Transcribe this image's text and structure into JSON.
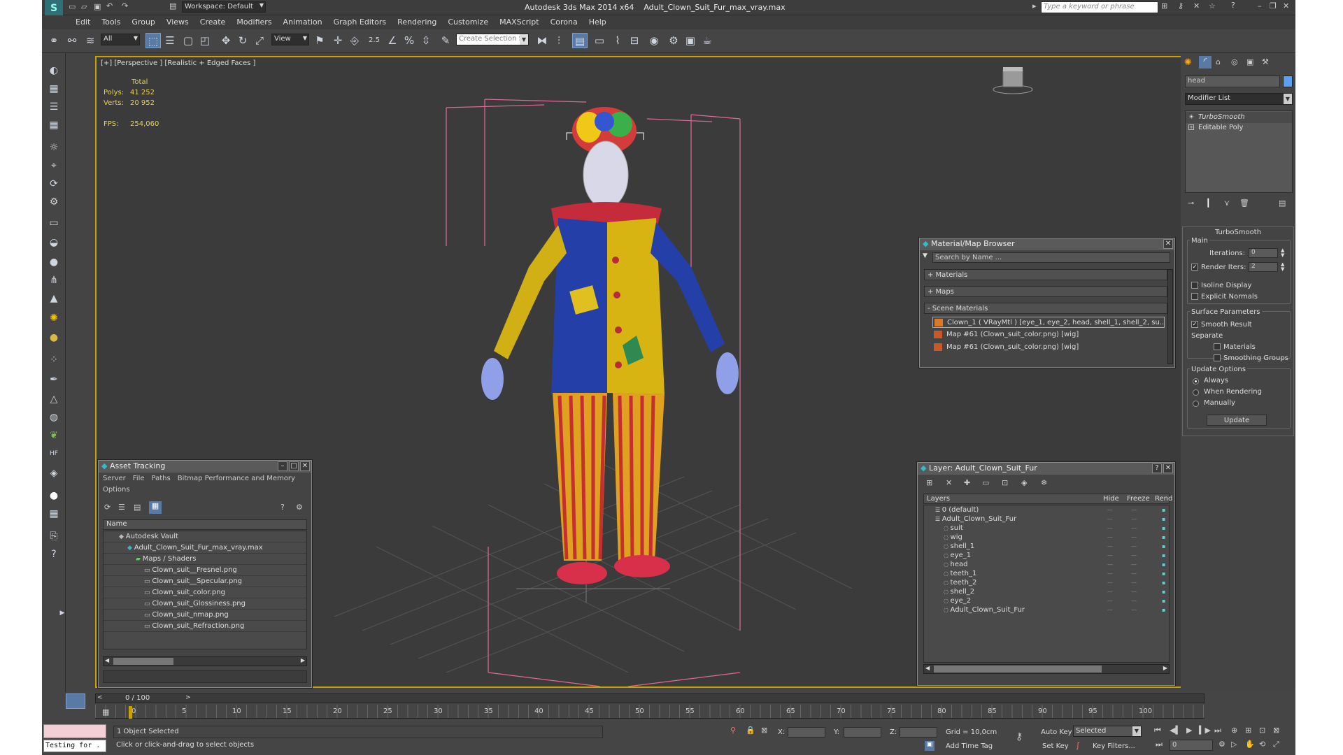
{
  "title": {
    "app": "Autodesk 3ds Max  2014 x64",
    "file": "Adult_Clown_Suit_Fur_max_vray.max",
    "workspace": "Workspace: Default",
    "search_placeholder": "Type a keyword or phrase"
  },
  "menu": [
    "Edit",
    "Tools",
    "Group",
    "Views",
    "Create",
    "Modifiers",
    "Animation",
    "Graph Editors",
    "Rendering",
    "Customize",
    "MAXScript",
    "Corona",
    "Help"
  ],
  "toolbar": {
    "filter": "All",
    "refcoord": "View",
    "snap_angle": "2.5",
    "named_selection": "Create Selection Se"
  },
  "viewport": {
    "label": "[+] [Perspective ] [Realistic + Edged Faces ]",
    "stats_header": "Total",
    "polys_label": "Polys:",
    "polys_value": "41 252",
    "verts_label": "Verts:",
    "verts_value": "20 952",
    "fps_label": "FPS:",
    "fps_value": "254,060"
  },
  "command_panel": {
    "object_name": "head",
    "modifier_list": "Modifier List",
    "stack": [
      "TurboSmooth",
      "Editable Poly"
    ],
    "rollout_title": "TurboSmooth",
    "main_group": "Main",
    "iterations_label": "Iterations:",
    "iterations_value": "0",
    "render_iters_label": "Render Iters:",
    "render_iters_value": "2",
    "isoline": "Isoline Display",
    "explicit_normals": "Explicit Normals",
    "surface_group": "Surface Parameters",
    "smooth_result": "Smooth Result",
    "separate_label": "Separate",
    "materials": "Materials",
    "smoothing_groups": "Smoothing Groups",
    "update_group": "Update Options",
    "always": "Always",
    "when_rendering": "When Rendering",
    "manually": "Manually",
    "update_button": "Update"
  },
  "material_browser": {
    "title": "Material/Map Browser",
    "search_placeholder": "Search by Name ...",
    "sections": [
      "+ Materials",
      "+ Maps",
      "- Scene Materials"
    ],
    "items": [
      "Clown_1  ( VRayMtl )  [eye_1, eye_2, head, shell_1, shell_2, su...",
      "Map #61 (Clown_suit_color.png)  [wig]",
      "Map #61 (Clown_suit_color.png)  [wig]"
    ]
  },
  "asset_tracking": {
    "title": "Asset Tracking",
    "menu": [
      "Server",
      "File",
      "Paths",
      "Bitmap Performance and Memory"
    ],
    "options": "Options",
    "column": "Name",
    "tree": [
      {
        "text": "Autodesk Vault",
        "level": 1
      },
      {
        "text": "Adult_Clown_Suit_Fur_max_vray.max",
        "level": 2
      },
      {
        "text": "Maps / Shaders",
        "level": 3
      },
      {
        "text": "Clown_suit__Fresnel.png",
        "level": 4
      },
      {
        "text": "Clown_suit__Specular.png",
        "level": 4
      },
      {
        "text": "Clown_suit_color.png",
        "level": 4
      },
      {
        "text": "Clown_suit_Glossiness.png",
        "level": 4
      },
      {
        "text": "Clown_suit_nmap.png",
        "level": 4
      },
      {
        "text": "Clown_suit_Refraction.png",
        "level": 4
      }
    ]
  },
  "layer_panel": {
    "title": "Layer: Adult_Clown_Suit_Fur",
    "help": "?",
    "columns": [
      "Layers",
      "Hide",
      "Freeze",
      "Rend"
    ],
    "layers": [
      {
        "text": "0 (default)",
        "level": 1
      },
      {
        "text": "Adult_Clown_Suit_Fur",
        "level": 1
      },
      {
        "text": "suit",
        "level": 2
      },
      {
        "text": "wig",
        "level": 2
      },
      {
        "text": "shell_1",
        "level": 2
      },
      {
        "text": "eye_1",
        "level": 2
      },
      {
        "text": "head",
        "level": 2
      },
      {
        "text": "teeth_1",
        "level": 2
      },
      {
        "text": "teeth_2",
        "level": 2
      },
      {
        "text": "shell_2",
        "level": 2
      },
      {
        "text": "eye_2",
        "level": 2
      },
      {
        "text": "Adult_Clown_Suit_Fur",
        "level": 2
      }
    ]
  },
  "timeline": {
    "frame": "0 / 100",
    "ticks": [
      "0",
      "5",
      "10",
      "15",
      "20",
      "25",
      "30",
      "35",
      "40",
      "45",
      "50",
      "55",
      "60",
      "65",
      "70",
      "75",
      "80",
      "85",
      "90",
      "95",
      "100"
    ]
  },
  "status": {
    "maxscript_listener": "Testing for .",
    "selected": "1 Object Selected",
    "prompt": "Click or click-and-drag to select objects",
    "x": "X:",
    "y": "Y:",
    "z": "Z:",
    "grid": "Grid = 10,0cm",
    "add_time_tag": "Add Time Tag",
    "auto_key": "Auto Key",
    "set_key": "Set Key",
    "selected_dd": "Selected",
    "key_filters": "Key Filters...",
    "frame_field": "0"
  }
}
